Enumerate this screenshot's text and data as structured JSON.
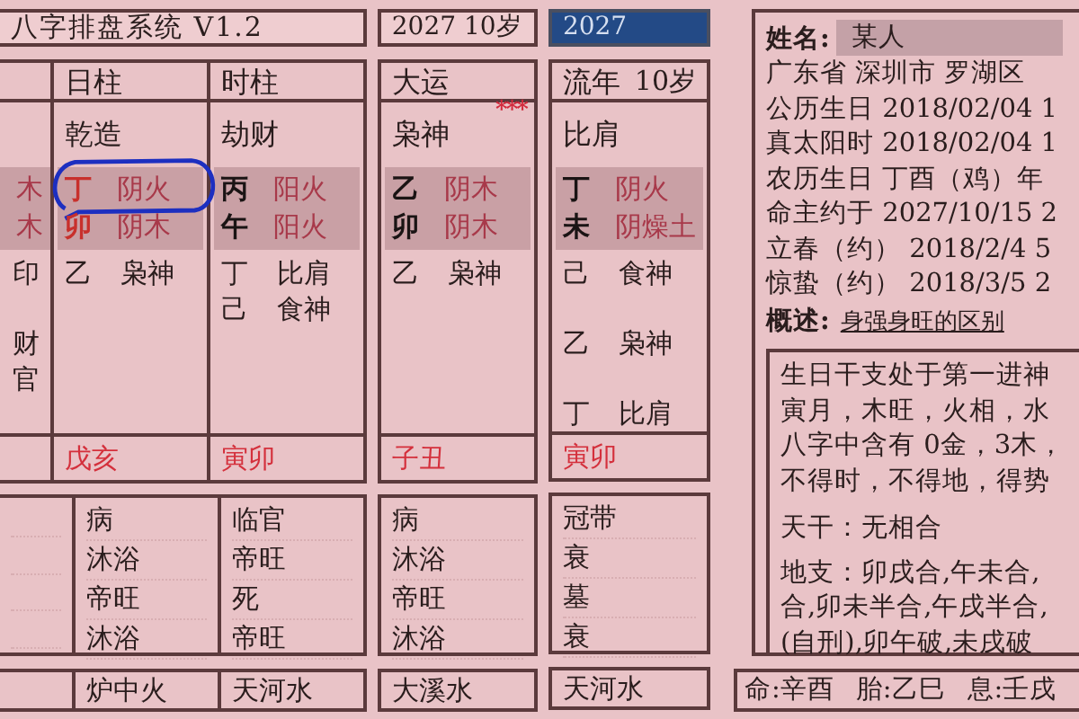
{
  "sections": [
    {
      "top": {
        "kind": "title",
        "text": "八字排盘系统 V1.2"
      },
      "pillars": [
        {
          "stem": {
            "element": "木"
          },
          "branch": {
            "element": "木"
          },
          "hidden": [
            {
              "kind": "entry",
              "god": "印"
            },
            {
              "kind": "blank"
            },
            {
              "kind": "entry",
              "god": "财"
            },
            {
              "kind": "entry",
              "god": "官"
            }
          ]
        },
        {
          "header": "日柱",
          "shishen": "乾造",
          "stem": {
            "char": "丁",
            "color": "#c8302c",
            "element": "阴火",
            "circled": true
          },
          "branch": {
            "char": "卯",
            "color": "#c8302c",
            "element": "阴木",
            "circled": false
          },
          "hidden": [
            {
              "kind": "entry",
              "stem": "乙",
              "god": "枭神"
            }
          ],
          "kongwang": "戊亥",
          "changsheng": [
            "病",
            "沐浴",
            "帝旺",
            "沐浴"
          ],
          "nayin": "炉中火"
        },
        {
          "header": "时柱",
          "shishen": "劫财",
          "stem": {
            "char": "丙",
            "color": "#1a1414",
            "element": "阳火",
            "circled": false
          },
          "branch": {
            "char": "午",
            "color": "#1a1414",
            "element": "阳火",
            "circled": false
          },
          "hidden": [
            {
              "kind": "entry",
              "stem": "丁",
              "god": "比肩"
            },
            {
              "kind": "entry",
              "stem": "己",
              "god": "食神"
            }
          ],
          "kongwang": "寅卯",
          "changsheng": [
            "临官",
            "帝旺",
            "死",
            "帝旺"
          ],
          "nayin": "天河水"
        }
      ]
    },
    {
      "top": {
        "kind": "label",
        "text": "2027 10岁"
      },
      "pillars": [
        {
          "header": "大运",
          "marker": "***",
          "shishen": "枭神",
          "stem": {
            "char": "乙",
            "color": "#1a1414",
            "element": "阴木",
            "circled": false
          },
          "branch": {
            "char": "卯",
            "color": "#1a1414",
            "element": "阴木",
            "circled": false
          },
          "hidden": [
            {
              "kind": "entry",
              "stem": "乙",
              "god": "枭神"
            }
          ],
          "kongwang": "子丑",
          "changsheng": [
            "病",
            "沐浴",
            "帝旺",
            "沐浴"
          ],
          "nayin": "大溪水"
        }
      ]
    },
    {
      "top": {
        "kind": "input",
        "text": "2027"
      },
      "pillars": [
        {
          "header": "流年",
          "age": "10岁",
          "shishen": "比肩",
          "stem": {
            "char": "丁",
            "color": "#1a1414",
            "element": "阴火",
            "circled": false
          },
          "branch": {
            "char": "未",
            "color": "#1a1414",
            "element": "阴燥土",
            "circled": false
          },
          "hidden": [
            {
              "kind": "entry",
              "stem": "己",
              "god": "食神"
            },
            {
              "kind": "blank"
            },
            {
              "kind": "entry",
              "stem": "乙",
              "god": "枭神"
            },
            {
              "kind": "blank"
            },
            {
              "kind": "entry",
              "stem": "丁",
              "god": "比肩"
            }
          ],
          "kongwang": "寅卯",
          "changsheng": [
            "冠带",
            "衰",
            "墓",
            "衰"
          ],
          "nayin": "天河水"
        }
      ]
    }
  ],
  "profile": {
    "name_label": "姓名:",
    "name": "某人",
    "lines": [
      "广东省 深圳市 罗湖区",
      "公历生日 2018/02/04 1",
      "真太阳时 2018/02/04 1",
      "农历生日 丁酉（鸡）年",
      "命主约于 2027/10/15 2",
      "立春（约） 2018/2/4 5",
      "惊蛰（约） 2018/3/5 2"
    ],
    "summary_label": "概述:",
    "summary_link": "身强身旺的区别",
    "analysis": [
      "生日干支处于第一进神",
      "寅月，木旺，火相，水",
      "八字中含有 0金，3木，",
      "不得时，不得地，得势"
    ],
    "relations": [
      "天干：无相合",
      "地支：卯戌合,午未合,",
      "合,卯未半合,午戌半合,",
      "(自刑),卯午破,未戌破"
    ]
  },
  "footer": [
    "命:辛酉",
    "胎:乙巳",
    "息:壬戌"
  ]
}
